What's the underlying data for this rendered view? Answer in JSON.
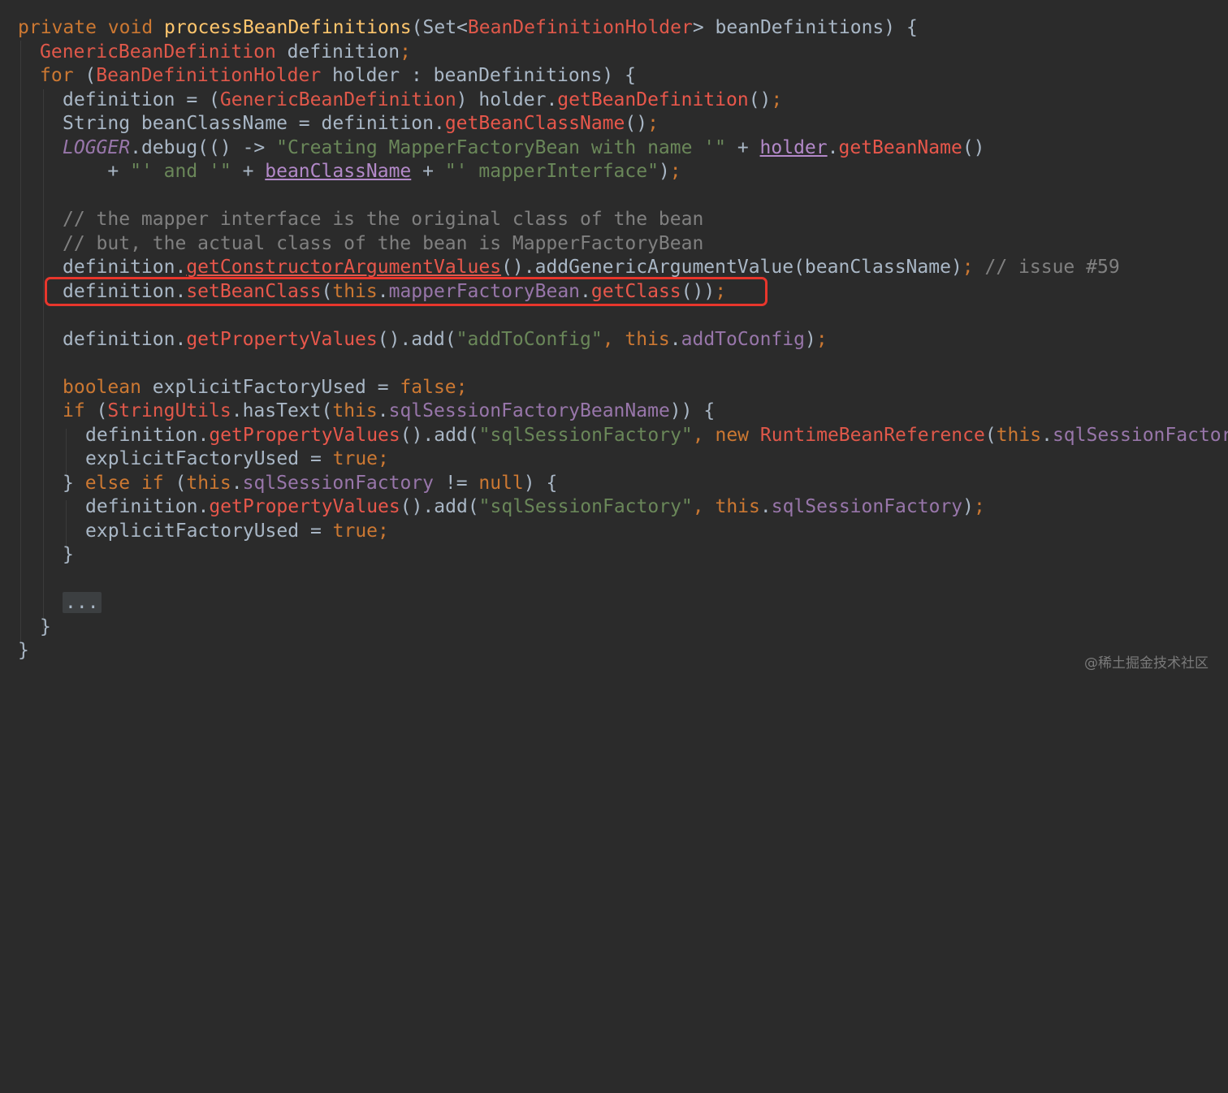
{
  "code": {
    "l1_kw": "private void ",
    "l1_fn": "processBeanDefinitions",
    "l1_a": "(Set<",
    "l1_ty": "BeanDefinitionHolder",
    "l1_b": "> beanDefinitions) {",
    "l2_ty": "GenericBeanDefinition",
    "l2_a": " definition",
    "l2_semi": ";",
    "l3_kw": "for ",
    "l3_a": "(",
    "l3_ty": "BeanDefinitionHolder",
    "l3_b": " holder : beanDefinitions) {",
    "l4_a": "definition = (",
    "l4_ty": "GenericBeanDefinition",
    "l4_b": ") holder.",
    "l4_mc": "getBeanDefinition",
    "l4_c": "()",
    "l4_semi": ";",
    "l5_a": "String beanClassName = definition.",
    "l5_mc": "getBeanClassName",
    "l5_b": "()",
    "l5_semi": ";",
    "l6_lg": "LOGGER",
    "l6_a": ".debug(() -> ",
    "l6_st": "\"Creating MapperFactoryBean with name '\"",
    "l6_b": " + ",
    "l6_ul": "holder",
    "l6_c": ".",
    "l6_mc": "getBeanName",
    "l6_d": "()",
    "l7_a": "    + ",
    "l7_st1": "\"' and '\"",
    "l7_b": " + ",
    "l7_ul": "beanClassName",
    "l7_c": " + ",
    "l7_st2": "\"' mapperInterface\"",
    "l7_d": ")",
    "l7_semi": ";",
    "l9_cm": "// the mapper interface is the original class of the bean",
    "l10_cm": "// but, the actual class of the bean is MapperFactoryBean",
    "l11_a": "definition.",
    "l11_mc": "getConstructorArgumentValues",
    "l11_b": "().addGenericArgumentValue(beanClassName)",
    "l11_semi": "; ",
    "l11_cm": "// issue #59",
    "l12_a": "definition.",
    "l12_mc": "setBeanClass",
    "l12_b": "(",
    "l12_kw": "this",
    "l12_c": ".",
    "l12_fd": "mapperFactoryBean",
    "l12_d": ".",
    "l12_mc2": "getClass",
    "l12_e": "())",
    "l12_semi": ";",
    "l14_a": "definition.",
    "l14_mc": "getPropertyValues",
    "l14_b": "().add(",
    "l14_st": "\"addToConfig\"",
    "l14_c": ", ",
    "l14_kw": "this",
    "l14_d": ".",
    "l14_fd": "addToConfig",
    "l14_e": ")",
    "l14_semi": ";",
    "l16_kw": "boolean ",
    "l16_a": "explicitFactoryUsed = ",
    "l16_kw2": "false",
    "l16_semi": ";",
    "l17_kw": "if ",
    "l17_a": "(",
    "l17_ty": "StringUtils",
    "l17_b": ".hasText(",
    "l17_kw2": "this",
    "l17_c": ".",
    "l17_fd": "sqlSessionFactoryBeanName",
    "l17_d": ")) {",
    "l18_a": "definition.",
    "l18_mc": "getPropertyValues",
    "l18_b": "().add(",
    "l18_st": "\"sqlSessionFactory\"",
    "l18_c": ", ",
    "l18_kw": "new ",
    "l18_ty": "RuntimeBeanReference",
    "l18_d": "(",
    "l18_kw2": "this",
    "l18_e": ".",
    "l18_fd": "sqlSessionFactory",
    "l19_a": "explicitFactoryUsed = ",
    "l19_kw": "true",
    "l19_semi": ";",
    "l20_a": "} ",
    "l20_kw": "else if ",
    "l20_b": "(",
    "l20_kw2": "this",
    "l20_c": ".",
    "l20_fd": "sqlSessionFactory",
    "l20_d": " != ",
    "l20_kw3": "null",
    "l20_e": ") {",
    "l21_a": "definition.",
    "l21_mc": "getPropertyValues",
    "l21_b": "().add(",
    "l21_st": "\"sqlSessionFactory\"",
    "l21_c": ", ",
    "l21_kw": "this",
    "l21_d": ".",
    "l21_fd": "sqlSessionFactory",
    "l21_e": ")",
    "l21_semi": ";",
    "l22_a": "explicitFactoryUsed = ",
    "l22_kw": "true",
    "l22_semi": ";",
    "l23_a": "}",
    "l25_fold": "...",
    "l26_a": "}",
    "l27_a": "}"
  },
  "watermark": "@稀土掘金技术社区",
  "colors": {
    "background": "#2b2b2b",
    "highlight_border": "#e8362c",
    "keyword": "#cc7832",
    "type": "#e0584a",
    "string": "#6a8759",
    "field": "#9876aa"
  }
}
